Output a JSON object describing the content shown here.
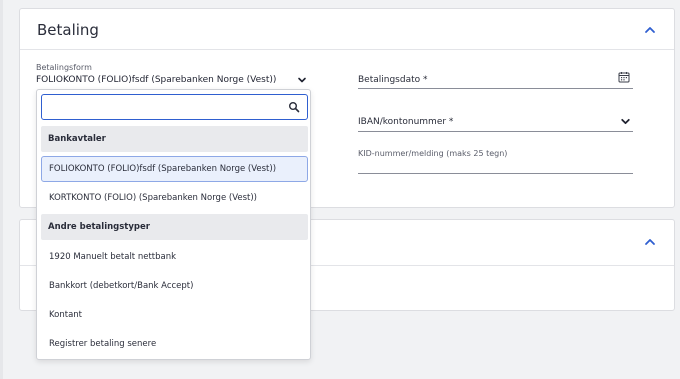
{
  "colors": {
    "accent": "#2f5fd0",
    "page_bg": "#f1f2f4",
    "card_bg": "#ffffff",
    "group_bg": "#e9eaed",
    "selected_bg": "#eaf0fc"
  },
  "betaling_card": {
    "title": "Betaling",
    "collapse_icon": "chevron-up-icon",
    "betalingsform": {
      "label": "Betalingsform",
      "value": "FOLIOKONTO (FOLIO)fsdf (Sparebanken Norge (Vest))",
      "icon": "chevron-down-icon"
    },
    "betalingsdato": {
      "placeholder": "Betalingsdato *",
      "icon": "calendar-icon"
    },
    "iban": {
      "placeholder": "IBAN/kontonummer *",
      "icon": "chevron-down-icon"
    },
    "kid": {
      "label": "KID-nummer/melding (maks 25 tegn)",
      "value": ""
    }
  },
  "second_card": {
    "collapse_icon": "chevron-up-icon"
  },
  "dropdown": {
    "search": {
      "value": "",
      "placeholder": "",
      "icon": "search-icon"
    },
    "groups": [
      {
        "label": "Bankavtaler",
        "options": [
          {
            "label": "FOLIOKONTO (FOLIO)fsdf (Sparebanken Norge (Vest))",
            "selected": true
          },
          {
            "label": "KORTKONTO (FOLIO) (Sparebanken Norge (Vest))",
            "selected": false
          }
        ]
      },
      {
        "label": "Andre betalingstyper",
        "options": [
          {
            "label": "1920 Manuelt betalt nettbank",
            "selected": false
          },
          {
            "label": "Bankkort (debetkort/Bank Accept)",
            "selected": false
          },
          {
            "label": "Kontant",
            "selected": false
          },
          {
            "label": "Registrer betaling senere",
            "selected": false
          }
        ]
      }
    ]
  }
}
